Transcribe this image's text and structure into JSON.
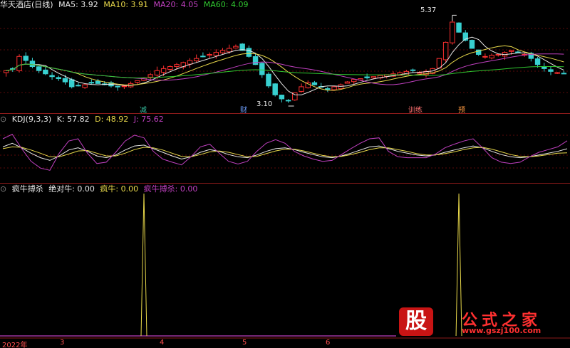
{
  "window": {
    "title": "华天酒店(日线)"
  },
  "price_panel": {
    "ma_legend": [
      {
        "label": "MA5: 3.92",
        "color": "#e8e8e8"
      },
      {
        "label": "MA10: 3.91",
        "color": "#e8d84a"
      },
      {
        "label": "MA20: 4.05",
        "color": "#c040c0"
      },
      {
        "label": "MA60: 4.09",
        "color": "#30c830"
      }
    ],
    "high_label": "5.37",
    "low_label": "3.10",
    "markers": [
      {
        "text": "减",
        "color": "#35c0a0"
      },
      {
        "text": "财",
        "color": "#6fa0ff"
      },
      {
        "text": "训练",
        "color": "#ff7070"
      },
      {
        "text": "预",
        "color": "#ff9a40"
      }
    ]
  },
  "kdj_panel": {
    "name": "KDJ(9,3,3)",
    "k": "K: 57.82",
    "d": "D: 48.92",
    "j": "J: 75.62",
    "k_color": "#e8e8e8",
    "d_color": "#e8d84a",
    "j_color": "#c040c0"
  },
  "signal_panel": {
    "name": "疯牛搏杀",
    "items": [
      {
        "label": "绝对牛: 0.00",
        "color": "#e8e8e8"
      },
      {
        "label": "疯牛: 0.00",
        "color": "#e8d84a"
      },
      {
        "label": "疯牛搏杀: 0.00",
        "color": "#c040c0"
      }
    ]
  },
  "x_axis": {
    "labels": [
      "2022年",
      "3",
      "4",
      "5",
      "6"
    ]
  },
  "watermark": {
    "logo_char": "股",
    "site_name": "公式之家",
    "url": "www.gszj100.com"
  },
  "chart_data": [
    {
      "type": "candlestick",
      "title": "华天酒店(日线)",
      "y_range": [
        3.0,
        5.5
      ],
      "high": 5.37,
      "low": 3.1,
      "closes": [
        4.0,
        4.05,
        4.35,
        4.25,
        4.1,
        4.0,
        3.92,
        3.85,
        3.8,
        3.72,
        3.6,
        3.62,
        3.65,
        3.7,
        3.68,
        3.65,
        3.62,
        3.6,
        3.62,
        3.68,
        3.75,
        3.82,
        3.9,
        4.0,
        4.05,
        4.1,
        4.15,
        4.2,
        4.25,
        4.3,
        4.35,
        4.4,
        4.45,
        4.5,
        4.55,
        4.6,
        4.5,
        4.35,
        4.15,
        3.9,
        3.62,
        3.4,
        3.3,
        3.25,
        3.45,
        3.6,
        3.7,
        3.65,
        3.6,
        3.55,
        3.6,
        3.65,
        3.72,
        3.78,
        3.8,
        3.82,
        3.85,
        3.88,
        3.9,
        3.92,
        3.95,
        3.98,
        4.0,
        3.95,
        3.98,
        4.05,
        4.3,
        4.7,
        5.2,
        4.95,
        4.75,
        4.55,
        4.4,
        4.35,
        4.38,
        4.4,
        4.45,
        4.5,
        4.45,
        4.4,
        4.3,
        4.15,
        4.05,
        3.98,
        3.95,
        3.92
      ]
    },
    {
      "type": "line",
      "title": "KDJ(9,3,3)",
      "y_range": [
        -10,
        110
      ],
      "series": [
        {
          "name": "K",
          "color": "#e8e8e8",
          "values": [
            62,
            70,
            60,
            48,
            38,
            32,
            42,
            55,
            60,
            52,
            42,
            38,
            44,
            55,
            64,
            66,
            58,
            50,
            42,
            35,
            40,
            50,
            56,
            52,
            45,
            40,
            38,
            44,
            52,
            58,
            60,
            56,
            50,
            45,
            40,
            38,
            42,
            48,
            55,
            62,
            64,
            58,
            52,
            48,
            44,
            42,
            44,
            50,
            55,
            60,
            64,
            60,
            52,
            45,
            40,
            38,
            40,
            44,
            48,
            52,
            57.82
          ]
        },
        {
          "name": "D",
          "color": "#e8d84a",
          "values": [
            58,
            62,
            61,
            55,
            48,
            40,
            40,
            46,
            53,
            54,
            48,
            42,
            42,
            48,
            56,
            61,
            60,
            55,
            48,
            41,
            40,
            45,
            51,
            53,
            50,
            45,
            40,
            41,
            47,
            53,
            57,
            57,
            53,
            48,
            43,
            40,
            41,
            45,
            50,
            56,
            60,
            60,
            56,
            52,
            47,
            44,
            44,
            47,
            51,
            56,
            60,
            61,
            57,
            51,
            45,
            41,
            40,
            42,
            45,
            48,
            48.92
          ]
        },
        {
          "name": "J",
          "color": "#c040c0",
          "values": [
            80,
            90,
            58,
            30,
            15,
            10,
            48,
            75,
            80,
            48,
            25,
            28,
            50,
            75,
            88,
            82,
            52,
            35,
            28,
            22,
            40,
            62,
            68,
            48,
            30,
            24,
            30,
            52,
            70,
            78,
            70,
            52,
            42,
            35,
            30,
            32,
            45,
            58,
            70,
            80,
            82,
            52,
            40,
            38,
            38,
            38,
            46,
            60,
            68,
            75,
            80,
            60,
            38,
            28,
            25,
            28,
            40,
            50,
            56,
            62,
            75.62
          ]
        }
      ]
    },
    {
      "type": "line",
      "title": "疯牛搏杀",
      "y_range": [
        0,
        1
      ],
      "n": 86,
      "series": [
        {
          "name": "绝对牛",
          "color": "#e8e8e8",
          "spikes": []
        },
        {
          "name": "疯牛",
          "color": "#e8d84a",
          "spikes": [
            21,
            69
          ]
        },
        {
          "name": "疯牛搏杀",
          "color": "#c040c0",
          "spikes": []
        }
      ]
    }
  ]
}
